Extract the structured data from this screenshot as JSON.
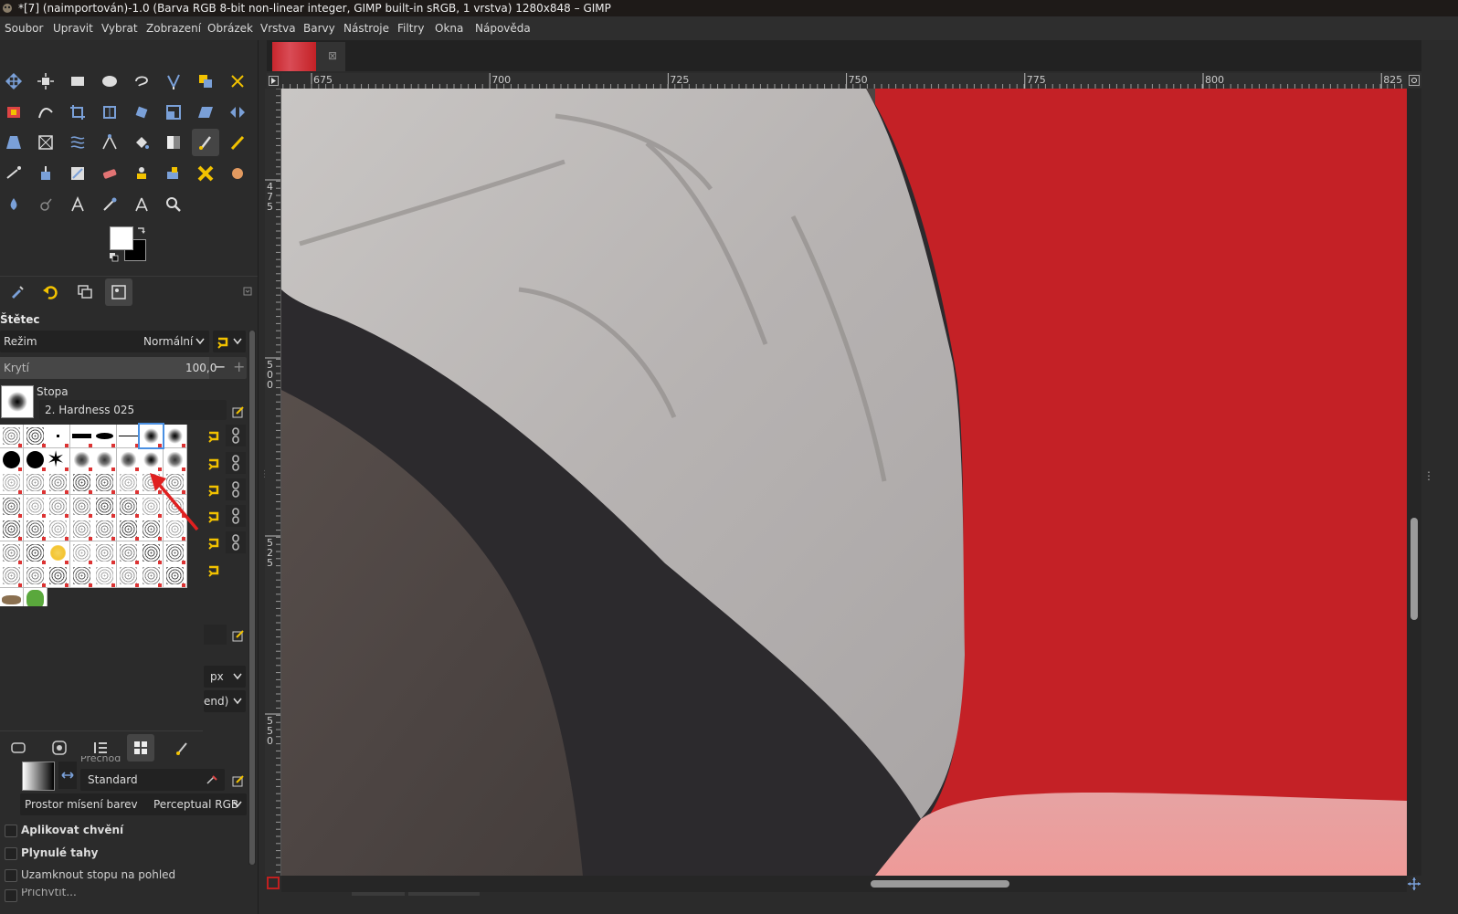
{
  "window": {
    "title": "*[7] (naimportován)-1.0 (Barva RGB 8-bit non-linear integer, GIMP built-in sRGB, 1 vrstva) 1280x848 – GIMP"
  },
  "menu": [
    "Soubor",
    "Upravit",
    "Vybrat",
    "Zobrazení",
    "Obrázek",
    "Vrstva",
    "Barvy",
    "Nástroje",
    "Filtry",
    "Okna",
    "Nápověda"
  ],
  "tool_options": {
    "tool_name": "Štětec",
    "mode_label": "Režim",
    "mode_value": "Normální",
    "opacity_label": "Krytí",
    "opacity_value": "100,0",
    "brush_label": "Stopa",
    "brush_value": "2. Hardness 025",
    "unit_value": "px",
    "dynamics_partial": "end)",
    "gradient_label_partial": "Přechod",
    "gradient_value": "Standard",
    "blend_space_label": "Prostor mísení barev",
    "blend_space_value": "Perceptual RGB",
    "checkboxes": [
      "Aplikovat chvění",
      "Plynulé tahy",
      "Uzamknout stopu na pohled",
      "Přichytit..."
    ]
  },
  "rulers": {
    "horizontal": [
      "675",
      "700",
      "725",
      "750",
      "775",
      "800",
      "825"
    ],
    "vertical": [
      "475",
      "500",
      "525",
      "550"
    ]
  },
  "icons": {
    "tools": [
      "move-icon",
      "align-icon",
      "rect-select-icon",
      "ellipse-select-icon",
      "lasso-icon",
      "fuzzy-select-icon",
      "by-color-select-icon",
      "scissors-icon",
      "foreground-select-icon",
      "paths-icon",
      "crop-icon",
      "unified-transform-icon",
      "rotate-icon",
      "scale-icon",
      "shear-icon",
      "flip-icon",
      "perspective-icon",
      "cage-icon",
      "warp-icon",
      "handle-transform-icon",
      "bucket-fill-icon",
      "gradient-icon",
      "paintbrush-icon",
      "pencil-icon",
      "airbrush-icon",
      "ink-icon",
      "mypaint-icon",
      "eraser-icon",
      "clone-icon",
      "heal-icon",
      "perspective-clone-icon",
      "smudge-icon",
      "blur-icon",
      "dodge-icon",
      "text-icon",
      "color-picker-icon",
      "measure-icon",
      "zoom-icon"
    ],
    "tabs": [
      "tool-options-tab-icon",
      "undo-history-tab-icon",
      "layers-tab-icon",
      "images-tab-icon"
    ],
    "bottom_tabs": [
      "fg-bg-tab-icon",
      "patterns-tab-icon",
      "brushes-list-tab-icon",
      "brushes-grid-tab-icon",
      "brush-paint-tab-icon"
    ]
  },
  "colors": {
    "foreground": "#ffffff",
    "background": "#000000",
    "accent_yellow": "#f2c200",
    "image_red": "#c42126"
  }
}
